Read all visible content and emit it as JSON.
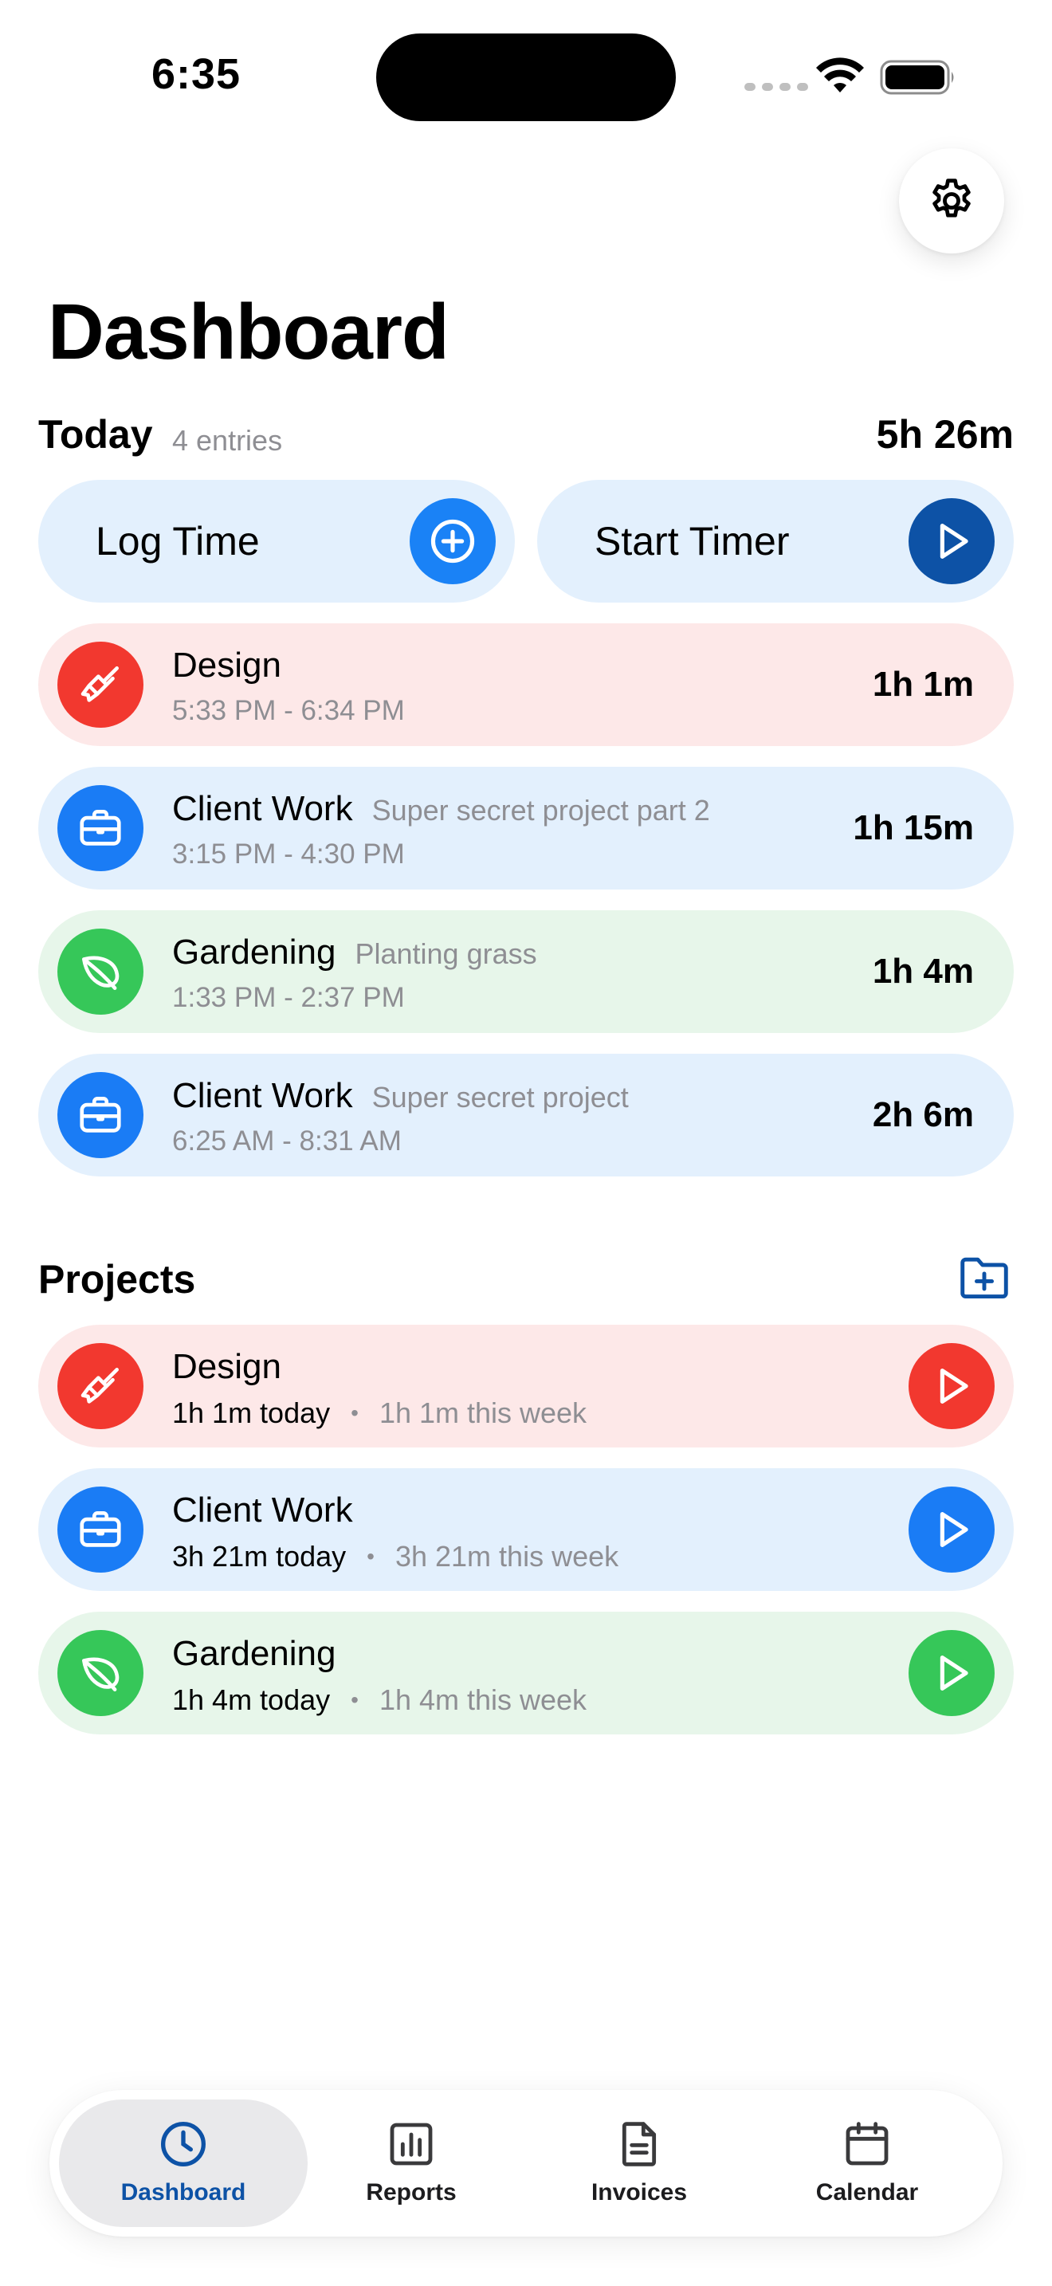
{
  "status_bar": {
    "time": "6:35"
  },
  "header": {
    "title": "Dashboard",
    "settings_icon": "gear-icon"
  },
  "today": {
    "label": "Today",
    "entry_count": "4 entries",
    "total": "5h 26m",
    "actions": [
      {
        "label": "Log Time",
        "icon": "plus-circle-icon",
        "color": "#1a82f6"
      },
      {
        "label": "Start Timer",
        "icon": "play-circle-icon",
        "color": "#0d52a6"
      }
    ],
    "entries": [
      {
        "project": "Design",
        "note": "",
        "time_range": "5:33 PM - 6:34 PM",
        "duration": "1h 1m",
        "icon": "paintbrush-icon",
        "color": "#f2382f"
      },
      {
        "project": "Client Work",
        "note": "Super secret project part 2",
        "time_range": "3:15 PM - 4:30 PM",
        "duration": "1h 15m",
        "icon": "briefcase-icon",
        "color": "#1a7cf5"
      },
      {
        "project": "Gardening",
        "note": "Planting grass",
        "time_range": "1:33 PM - 2:37 PM",
        "duration": "1h 4m",
        "icon": "leaf-icon",
        "color": "#36c759"
      },
      {
        "project": "Client Work",
        "note": "Super secret project",
        "time_range": "6:25 AM - 8:31 AM",
        "duration": "2h 6m",
        "icon": "briefcase-icon",
        "color": "#1a7cf5"
      }
    ]
  },
  "projects": {
    "label": "Projects",
    "add_icon": "folder-plus-icon",
    "items": [
      {
        "name": "Design",
        "today": "1h 1m today",
        "week": "1h 1m this week",
        "icon": "paintbrush-icon",
        "color": "#f2382f"
      },
      {
        "name": "Client Work",
        "today": "3h 21m today",
        "week": "3h 21m this week",
        "icon": "briefcase-icon",
        "color": "#1a7cf5"
      },
      {
        "name": "Gardening",
        "today": "1h 4m today",
        "week": "1h 4m this week",
        "icon": "leaf-icon",
        "color": "#36c759"
      }
    ],
    "separator": "•"
  },
  "tabbar": {
    "tabs": [
      {
        "label": "Dashboard",
        "icon": "clock-icon",
        "active": true
      },
      {
        "label": "Reports",
        "icon": "bar-chart-icon",
        "active": false
      },
      {
        "label": "Invoices",
        "icon": "document-icon",
        "active": false
      },
      {
        "label": "Calendar",
        "icon": "calendar-icon",
        "active": false
      }
    ],
    "active_color": "#0d52a6"
  }
}
